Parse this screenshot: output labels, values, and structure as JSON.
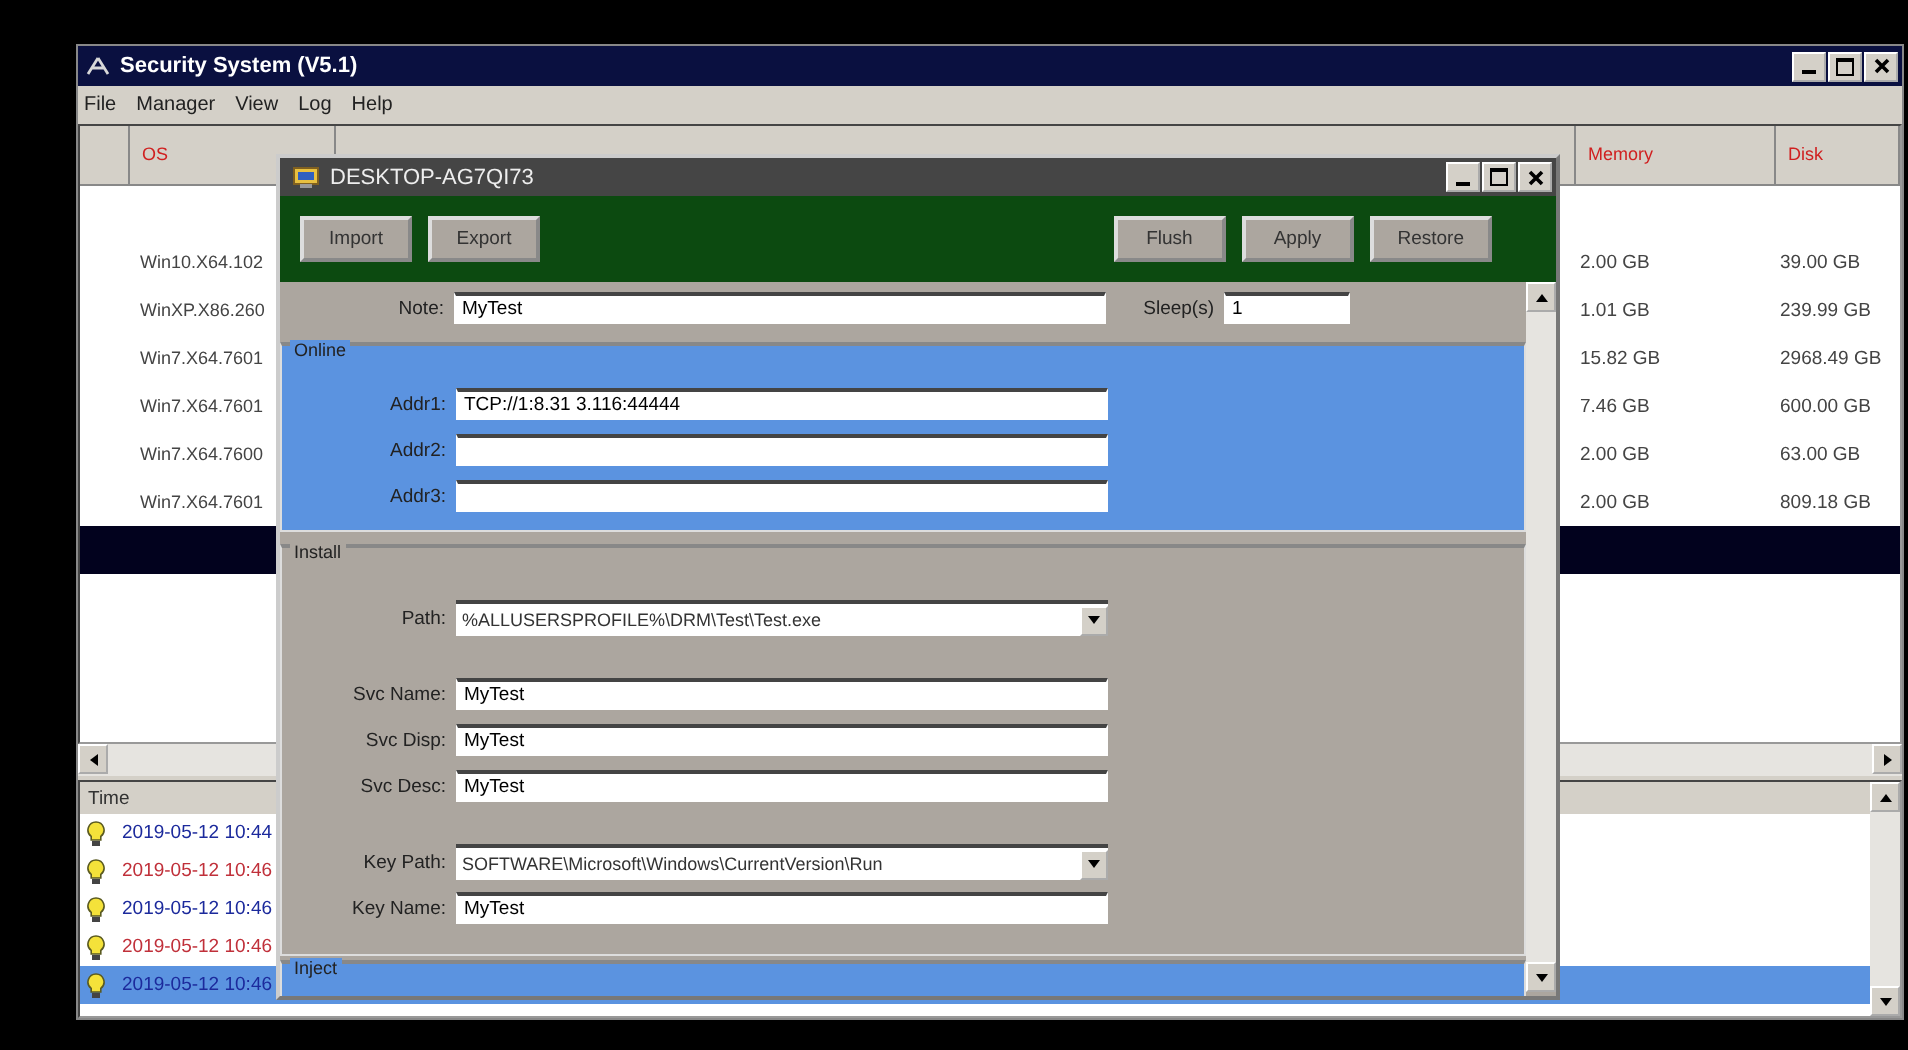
{
  "window": {
    "title": "Security System (V5.1)"
  },
  "menu": [
    "File",
    "Manager",
    "View",
    "Log",
    "Help"
  ],
  "table": {
    "columns": [
      {
        "label": "OS"
      },
      {
        "label": "Memory"
      },
      {
        "label": "Disk"
      }
    ],
    "rows": [
      {
        "cells": [
          "Win10.X64.102",
          "2.00 GB",
          "39.00 GB"
        ],
        "selected": false
      },
      {
        "cells": [
          "WinXP.X86.260",
          "1.01 GB",
          "239.99 GB"
        ],
        "selected": false
      },
      {
        "cells": [
          "Win7.X64.7601",
          "15.82 GB",
          "2968.49 GB"
        ],
        "selected": false
      },
      {
        "cells": [
          "Win7.X64.7601",
          "7.46 GB",
          "600.00 GB"
        ],
        "selected": false
      },
      {
        "cells": [
          "Win7.X64.7600",
          "2.00 GB",
          "63.00 GB"
        ],
        "selected": false
      },
      {
        "cells": [
          "Win7.X64.7601",
          "2.00 GB",
          "809.18 GB"
        ],
        "selected": false
      },
      {
        "selected": true
      }
    ]
  },
  "log": {
    "columns": [
      "Time"
    ],
    "rows": [
      {
        "time": "2019-05-12 10:44",
        "color": "#1c2a9c",
        "selected": false
      },
      {
        "time": "2019-05-12 10:46",
        "color": "#c0303a",
        "selected": false
      },
      {
        "time": "2019-05-12 10:46",
        "color": "#1c2a9c",
        "selected": false
      },
      {
        "time": "2019-05-12 10:46",
        "color": "#c0303a",
        "selected": false
      },
      {
        "time": "2019-05-12 10:46",
        "color": "#1c2a9c",
        "selected": true
      }
    ]
  },
  "dialog": {
    "title": "DESKTOP-AG7QI73",
    "toolbar_left": [
      "Import",
      "Export"
    ],
    "toolbar_right": [
      "Flush",
      "Apply",
      "Restore"
    ],
    "note": {
      "label": "Note:",
      "value": "MyTest"
    },
    "sleep": {
      "label": "Sleep(s)",
      "value": "1"
    },
    "groups": [
      {
        "title": "Online",
        "kind": "blue",
        "sections": [
          [
            {
              "label": "Addr1:",
              "kind": "text",
              "value": "TCP://1:8.31 3.116:44444"
            },
            {
              "label": "Addr2:",
              "kind": "text"
            },
            {
              "label": "Addr3:",
              "kind": "text"
            }
          ]
        ]
      },
      {
        "title": "Install",
        "kind": "gray",
        "sections": [
          [
            {
              "label": "Path:",
              "kind": "combo",
              "value": "%ALLUSERSPROFILE%\\DRM\\Test\\Test.exe"
            }
          ],
          [
            {
              "label": "Svc Name:",
              "kind": "text",
              "value": "MyTest"
            },
            {
              "label": "Svc Disp:",
              "kind": "text",
              "value": "MyTest"
            },
            {
              "label": "Svc Desc:",
              "kind": "text",
              "value": "MyTest"
            }
          ],
          [
            {
              "label": "Key Path:",
              "kind": "combo",
              "value": "SOFTWARE\\Microsoft\\Windows\\CurrentVersion\\Run"
            },
            {
              "label": "Key Name:",
              "kind": "text",
              "value": "MyTest"
            }
          ]
        ]
      },
      {
        "title": "Inject",
        "kind": "blue"
      }
    ]
  }
}
